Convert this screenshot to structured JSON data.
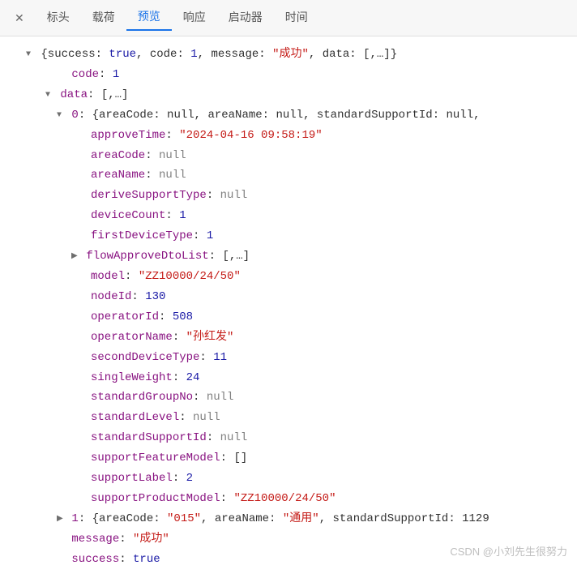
{
  "tabs": {
    "close": "✕",
    "items": [
      "标头",
      "载荷",
      "预览",
      "响应",
      "启动器",
      "时间"
    ],
    "activeIndex": 2
  },
  "root": {
    "summary_open": "{success: ",
    "summary_true": "true",
    "summary_mid1": ", code: ",
    "summary_code": "1",
    "summary_mid2": ", message: ",
    "summary_msg": "\"成功\"",
    "summary_mid3": ", data: [,…]}",
    "code": {
      "key": "code",
      "val": "1"
    },
    "data": {
      "key": "data",
      "val": "[,…]"
    },
    "item0": {
      "idx": "0",
      "summary": "{areaCode: null, areaName: null, standardSupportId: null,",
      "fields": [
        {
          "key": "approveTime",
          "type": "str",
          "val": "\"2024-04-16 09:58:19\""
        },
        {
          "key": "areaCode",
          "type": "null",
          "val": "null"
        },
        {
          "key": "areaName",
          "type": "null",
          "val": "null"
        },
        {
          "key": "deriveSupportType",
          "type": "null",
          "val": "null"
        },
        {
          "key": "deviceCount",
          "type": "num",
          "val": "1"
        },
        {
          "key": "firstDeviceType",
          "type": "num",
          "val": "1"
        }
      ],
      "flow": {
        "key": "flowApproveDtoList",
        "val": "[,…]"
      },
      "fields2": [
        {
          "key": "model",
          "type": "str",
          "val": "\"ZZ10000/24/50\""
        },
        {
          "key": "nodeId",
          "type": "num",
          "val": "130"
        },
        {
          "key": "operatorId",
          "type": "num",
          "val": "508"
        },
        {
          "key": "operatorName",
          "type": "str",
          "val": "\"孙红发\""
        },
        {
          "key": "secondDeviceType",
          "type": "num",
          "val": "11"
        },
        {
          "key": "singleWeight",
          "type": "num",
          "val": "24"
        },
        {
          "key": "standardGroupNo",
          "type": "null",
          "val": "null"
        },
        {
          "key": "standardLevel",
          "type": "null",
          "val": "null"
        },
        {
          "key": "standardSupportId",
          "type": "null",
          "val": "null"
        },
        {
          "key": "supportFeatureModel",
          "type": "arr",
          "val": "[]"
        },
        {
          "key": "supportLabel",
          "type": "num",
          "val": "2"
        },
        {
          "key": "supportProductModel",
          "type": "str",
          "val": "\"ZZ10000/24/50\""
        }
      ]
    },
    "item1": {
      "idx": "1",
      "areaCode": "\"015\"",
      "areaName": "\"通用\"",
      "tail": ", standardSupportId: 1129"
    },
    "message": {
      "key": "message",
      "val": "\"成功\""
    },
    "success": {
      "key": "success",
      "val": "true"
    }
  },
  "watermark": "CSDN @小刘先生很努力"
}
